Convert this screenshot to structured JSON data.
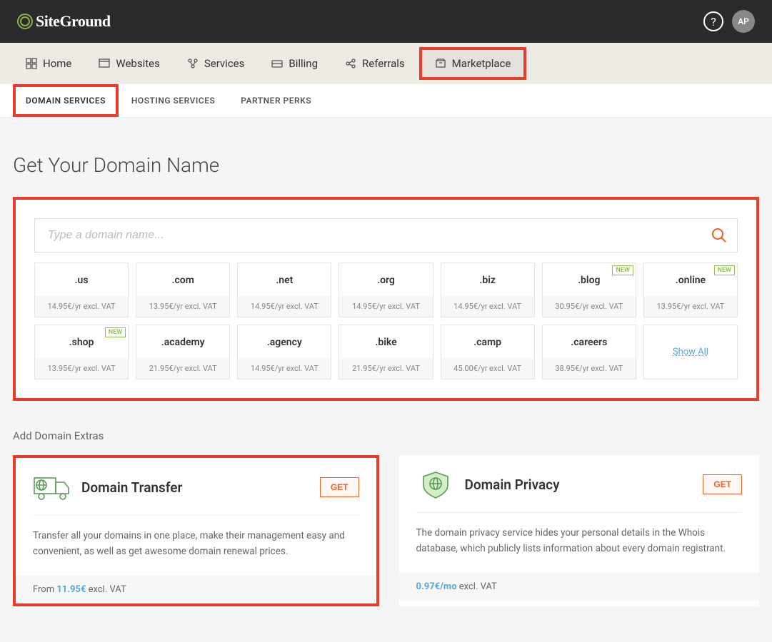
{
  "header": {
    "logo_text": "SiteGround",
    "avatar_initials": "AP"
  },
  "main_nav": [
    {
      "label": "Home"
    },
    {
      "label": "Websites"
    },
    {
      "label": "Services"
    },
    {
      "label": "Billing"
    },
    {
      "label": "Referrals"
    },
    {
      "label": "Marketplace",
      "highlighted": true
    }
  ],
  "sub_nav": [
    {
      "label": "DOMAIN SERVICES",
      "active": true,
      "highlighted": true
    },
    {
      "label": "HOSTING SERVICES"
    },
    {
      "label": "PARTNER PERKS"
    }
  ],
  "page_title": "Get Your Domain Name",
  "search": {
    "placeholder": "Type a domain name..."
  },
  "tlds": [
    {
      "name": ".us",
      "price": "14.95€/yr excl. VAT"
    },
    {
      "name": ".com",
      "price": "13.95€/yr excl. VAT"
    },
    {
      "name": ".net",
      "price": "14.95€/yr excl. VAT"
    },
    {
      "name": ".org",
      "price": "14.95€/yr excl. VAT"
    },
    {
      "name": ".biz",
      "price": "14.95€/yr excl. VAT"
    },
    {
      "name": ".blog",
      "price": "30.95€/yr excl. VAT",
      "new": true
    },
    {
      "name": ".online",
      "price": "13.95€/yr excl. VAT",
      "new": true
    },
    {
      "name": ".shop",
      "price": "13.95€/yr excl. VAT",
      "new": true
    },
    {
      "name": ".academy",
      "price": "21.95€/yr excl. VAT"
    },
    {
      "name": ".agency",
      "price": "14.95€/yr excl. VAT"
    },
    {
      "name": ".bike",
      "price": "21.95€/yr excl. VAT"
    },
    {
      "name": ".camp",
      "price": "45.00€/yr excl. VAT"
    },
    {
      "name": ".careers",
      "price": "38.95€/yr excl. VAT"
    }
  ],
  "new_badge_text": "NEW",
  "show_all_label": "Show All",
  "extras_title": "Add Domain Extras",
  "extras": [
    {
      "title": "Domain Transfer",
      "get_label": "GET",
      "desc": "Transfer all your domains in one place, make their management easy and convenient, as well as get awesome domain renewal prices.",
      "footer_prefix": "From ",
      "footer_price": "11.95€",
      "footer_suffix": " excl. VAT",
      "highlighted": true
    },
    {
      "title": "Domain Privacy",
      "get_label": "GET",
      "desc": "The domain privacy service hides your personal details in the Whois database, which publicly lists information about every domain registrant.",
      "footer_prefix": "",
      "footer_price": "0.97€/mo",
      "footer_suffix": " excl. VAT",
      "highlighted": false
    }
  ]
}
